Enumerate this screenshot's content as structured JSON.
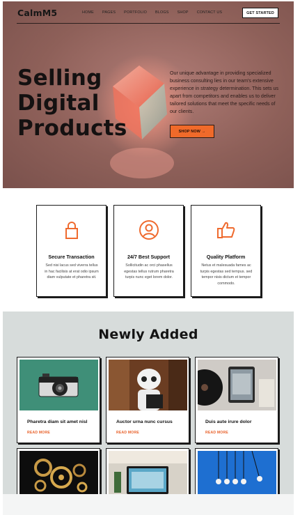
{
  "brand": {
    "logo": "CalmM5"
  },
  "nav": {
    "links": [
      "HOME",
      "PAGES",
      "PORTFOLIO",
      "BLOGS",
      "SHOP",
      "CONTACT US"
    ],
    "cta": "GET STARTED"
  },
  "hero": {
    "title_lines": [
      "Selling",
      "Digital",
      "Products"
    ],
    "description": "Our unique advantage in providing specialized business consulting lies in our team's extensive experience in strategy determination. This sets us apart from competitors and enables us to deliver tailored solutions that meet the specific needs of our clients.",
    "button": "SHOP NOW →"
  },
  "features": [
    {
      "icon": "lock-icon",
      "title": "Secure Transaction",
      "text": "Sed nisi lacus sed viverra tellus in hac facilisis at erat odio ipsum diam vulputate et pharetra sit."
    },
    {
      "icon": "support-icon",
      "title": "24/7 Best Support",
      "text": "Sollicitudin ac orci phasellus egestas tellus rutrum pharetra turpis nunc eget lorem dolor."
    },
    {
      "icon": "thumbs-up-icon",
      "title": "Quality Platform",
      "text": "Netus et malesuada fames ac turpis egestas sed tempus. sed tempor nisis dictum et tempor commodo."
    }
  ],
  "newly_added": {
    "title": "Newly Added",
    "cards": [
      {
        "title": "Pharetra diam sit amet nisl",
        "link": "READ MORE",
        "image": "camera-photo"
      },
      {
        "title": "Auctor urna nunc cursus",
        "link": "READ MORE",
        "image": "robot-photo"
      },
      {
        "title": "Duis aute irure dolor",
        "link": "READ MORE",
        "image": "tablet-photo"
      },
      {
        "title": "",
        "link": "",
        "image": "gears-photo"
      },
      {
        "title": "",
        "link": "",
        "image": "laptop-photo"
      },
      {
        "title": "",
        "link": "",
        "image": "bulbs-photo"
      }
    ]
  },
  "colors": {
    "accent": "#f06a2a",
    "hero_bg": "#8e6059",
    "section_bg": "#d7dcdb",
    "link": "#e8612a"
  }
}
